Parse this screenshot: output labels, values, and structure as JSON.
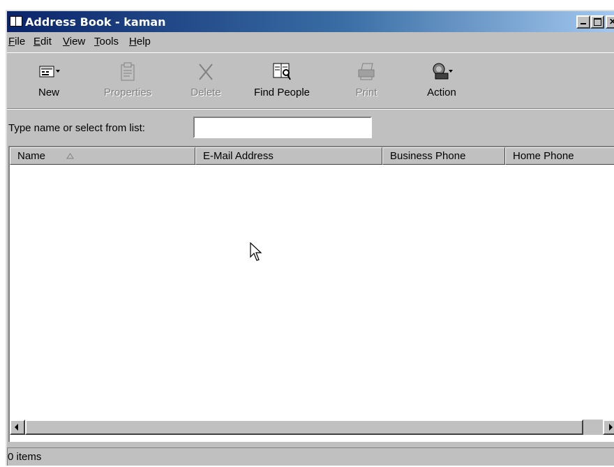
{
  "window": {
    "title": "Address Book - kaman",
    "controls": [
      "minimize",
      "maximize",
      "close"
    ]
  },
  "menubar": {
    "items": [
      {
        "label": "File",
        "underline": "F"
      },
      {
        "label": "Edit",
        "underline": "E"
      },
      {
        "label": "View",
        "underline": "V"
      },
      {
        "label": "Tools",
        "underline": "T"
      },
      {
        "label": "Help",
        "underline": "H"
      }
    ]
  },
  "toolbar": {
    "buttons": [
      {
        "label": "New",
        "icon": "new-contact-icon",
        "enabled": true,
        "dropdown": true
      },
      {
        "label": "Properties",
        "icon": "properties-icon",
        "enabled": false
      },
      {
        "label": "Delete",
        "icon": "delete-icon",
        "enabled": false
      },
      {
        "label": "Find People",
        "icon": "find-people-icon",
        "enabled": true
      },
      {
        "label": "Print",
        "icon": "print-icon",
        "enabled": false
      },
      {
        "label": "Action",
        "icon": "action-phone-icon",
        "enabled": true,
        "dropdown": true
      }
    ]
  },
  "find": {
    "label": "Type name or select from list:",
    "value": ""
  },
  "list": {
    "columns": [
      {
        "label": "Name",
        "sorted": "ascending"
      },
      {
        "label": "E-Mail Address"
      },
      {
        "label": "Business Phone"
      },
      {
        "label": "Home Phone"
      }
    ],
    "rows": []
  },
  "status": {
    "text": "0 items"
  }
}
